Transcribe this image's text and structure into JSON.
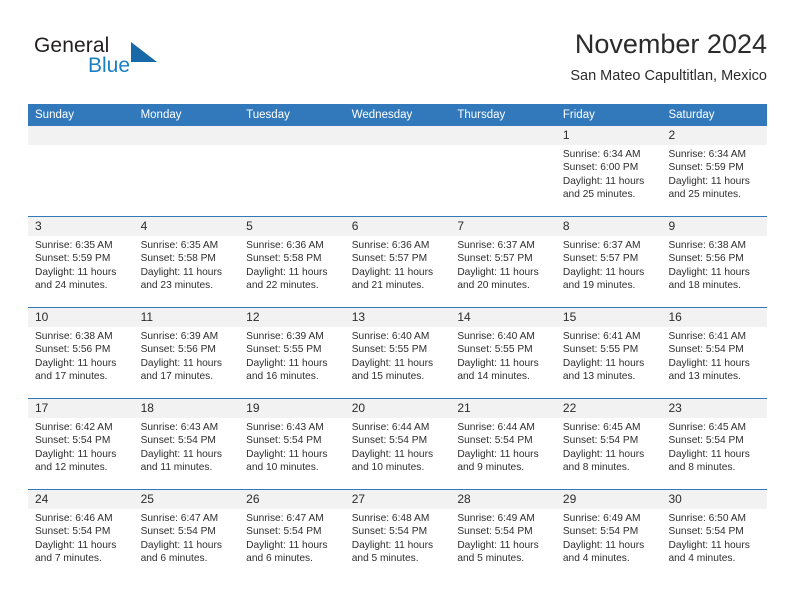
{
  "brand": {
    "name_part1": "General",
    "name_part2": "Blue",
    "triangle_icon": "triangle-icon",
    "accent_color": "#1b7fc4"
  },
  "header": {
    "title": "November 2024",
    "location": "San Mateo Capultitlan, Mexico"
  },
  "theme": {
    "header_blue": "#3279bc",
    "day_band_gray": "#f2f2f2",
    "text_color": "#2e2e2e"
  },
  "weekdays": [
    "Sunday",
    "Monday",
    "Tuesday",
    "Wednesday",
    "Thursday",
    "Friday",
    "Saturday"
  ],
  "weeks": [
    [
      {
        "day": "",
        "sunrise": "",
        "sunset": "",
        "daylight1": "",
        "daylight2": ""
      },
      {
        "day": "",
        "sunrise": "",
        "sunset": "",
        "daylight1": "",
        "daylight2": ""
      },
      {
        "day": "",
        "sunrise": "",
        "sunset": "",
        "daylight1": "",
        "daylight2": ""
      },
      {
        "day": "",
        "sunrise": "",
        "sunset": "",
        "daylight1": "",
        "daylight2": ""
      },
      {
        "day": "",
        "sunrise": "",
        "sunset": "",
        "daylight1": "",
        "daylight2": ""
      },
      {
        "day": "1",
        "sunrise": "Sunrise: 6:34 AM",
        "sunset": "Sunset: 6:00 PM",
        "daylight1": "Daylight: 11 hours",
        "daylight2": "and 25 minutes."
      },
      {
        "day": "2",
        "sunrise": "Sunrise: 6:34 AM",
        "sunset": "Sunset: 5:59 PM",
        "daylight1": "Daylight: 11 hours",
        "daylight2": "and 25 minutes."
      }
    ],
    [
      {
        "day": "3",
        "sunrise": "Sunrise: 6:35 AM",
        "sunset": "Sunset: 5:59 PM",
        "daylight1": "Daylight: 11 hours",
        "daylight2": "and 24 minutes."
      },
      {
        "day": "4",
        "sunrise": "Sunrise: 6:35 AM",
        "sunset": "Sunset: 5:58 PM",
        "daylight1": "Daylight: 11 hours",
        "daylight2": "and 23 minutes."
      },
      {
        "day": "5",
        "sunrise": "Sunrise: 6:36 AM",
        "sunset": "Sunset: 5:58 PM",
        "daylight1": "Daylight: 11 hours",
        "daylight2": "and 22 minutes."
      },
      {
        "day": "6",
        "sunrise": "Sunrise: 6:36 AM",
        "sunset": "Sunset: 5:57 PM",
        "daylight1": "Daylight: 11 hours",
        "daylight2": "and 21 minutes."
      },
      {
        "day": "7",
        "sunrise": "Sunrise: 6:37 AM",
        "sunset": "Sunset: 5:57 PM",
        "daylight1": "Daylight: 11 hours",
        "daylight2": "and 20 minutes."
      },
      {
        "day": "8",
        "sunrise": "Sunrise: 6:37 AM",
        "sunset": "Sunset: 5:57 PM",
        "daylight1": "Daylight: 11 hours",
        "daylight2": "and 19 minutes."
      },
      {
        "day": "9",
        "sunrise": "Sunrise: 6:38 AM",
        "sunset": "Sunset: 5:56 PM",
        "daylight1": "Daylight: 11 hours",
        "daylight2": "and 18 minutes."
      }
    ],
    [
      {
        "day": "10",
        "sunrise": "Sunrise: 6:38 AM",
        "sunset": "Sunset: 5:56 PM",
        "daylight1": "Daylight: 11 hours",
        "daylight2": "and 17 minutes."
      },
      {
        "day": "11",
        "sunrise": "Sunrise: 6:39 AM",
        "sunset": "Sunset: 5:56 PM",
        "daylight1": "Daylight: 11 hours",
        "daylight2": "and 17 minutes."
      },
      {
        "day": "12",
        "sunrise": "Sunrise: 6:39 AM",
        "sunset": "Sunset: 5:55 PM",
        "daylight1": "Daylight: 11 hours",
        "daylight2": "and 16 minutes."
      },
      {
        "day": "13",
        "sunrise": "Sunrise: 6:40 AM",
        "sunset": "Sunset: 5:55 PM",
        "daylight1": "Daylight: 11 hours",
        "daylight2": "and 15 minutes."
      },
      {
        "day": "14",
        "sunrise": "Sunrise: 6:40 AM",
        "sunset": "Sunset: 5:55 PM",
        "daylight1": "Daylight: 11 hours",
        "daylight2": "and 14 minutes."
      },
      {
        "day": "15",
        "sunrise": "Sunrise: 6:41 AM",
        "sunset": "Sunset: 5:55 PM",
        "daylight1": "Daylight: 11 hours",
        "daylight2": "and 13 minutes."
      },
      {
        "day": "16",
        "sunrise": "Sunrise: 6:41 AM",
        "sunset": "Sunset: 5:54 PM",
        "daylight1": "Daylight: 11 hours",
        "daylight2": "and 13 minutes."
      }
    ],
    [
      {
        "day": "17",
        "sunrise": "Sunrise: 6:42 AM",
        "sunset": "Sunset: 5:54 PM",
        "daylight1": "Daylight: 11 hours",
        "daylight2": "and 12 minutes."
      },
      {
        "day": "18",
        "sunrise": "Sunrise: 6:43 AM",
        "sunset": "Sunset: 5:54 PM",
        "daylight1": "Daylight: 11 hours",
        "daylight2": "and 11 minutes."
      },
      {
        "day": "19",
        "sunrise": "Sunrise: 6:43 AM",
        "sunset": "Sunset: 5:54 PM",
        "daylight1": "Daylight: 11 hours",
        "daylight2": "and 10 minutes."
      },
      {
        "day": "20",
        "sunrise": "Sunrise: 6:44 AM",
        "sunset": "Sunset: 5:54 PM",
        "daylight1": "Daylight: 11 hours",
        "daylight2": "and 10 minutes."
      },
      {
        "day": "21",
        "sunrise": "Sunrise: 6:44 AM",
        "sunset": "Sunset: 5:54 PM",
        "daylight1": "Daylight: 11 hours",
        "daylight2": "and 9 minutes."
      },
      {
        "day": "22",
        "sunrise": "Sunrise: 6:45 AM",
        "sunset": "Sunset: 5:54 PM",
        "daylight1": "Daylight: 11 hours",
        "daylight2": "and 8 minutes."
      },
      {
        "day": "23",
        "sunrise": "Sunrise: 6:45 AM",
        "sunset": "Sunset: 5:54 PM",
        "daylight1": "Daylight: 11 hours",
        "daylight2": "and 8 minutes."
      }
    ],
    [
      {
        "day": "24",
        "sunrise": "Sunrise: 6:46 AM",
        "sunset": "Sunset: 5:54 PM",
        "daylight1": "Daylight: 11 hours",
        "daylight2": "and 7 minutes."
      },
      {
        "day": "25",
        "sunrise": "Sunrise: 6:47 AM",
        "sunset": "Sunset: 5:54 PM",
        "daylight1": "Daylight: 11 hours",
        "daylight2": "and 6 minutes."
      },
      {
        "day": "26",
        "sunrise": "Sunrise: 6:47 AM",
        "sunset": "Sunset: 5:54 PM",
        "daylight1": "Daylight: 11 hours",
        "daylight2": "and 6 minutes."
      },
      {
        "day": "27",
        "sunrise": "Sunrise: 6:48 AM",
        "sunset": "Sunset: 5:54 PM",
        "daylight1": "Daylight: 11 hours",
        "daylight2": "and 5 minutes."
      },
      {
        "day": "28",
        "sunrise": "Sunrise: 6:49 AM",
        "sunset": "Sunset: 5:54 PM",
        "daylight1": "Daylight: 11 hours",
        "daylight2": "and 5 minutes."
      },
      {
        "day": "29",
        "sunrise": "Sunrise: 6:49 AM",
        "sunset": "Sunset: 5:54 PM",
        "daylight1": "Daylight: 11 hours",
        "daylight2": "and 4 minutes."
      },
      {
        "day": "30",
        "sunrise": "Sunrise: 6:50 AM",
        "sunset": "Sunset: 5:54 PM",
        "daylight1": "Daylight: 11 hours",
        "daylight2": "and 4 minutes."
      }
    ]
  ]
}
